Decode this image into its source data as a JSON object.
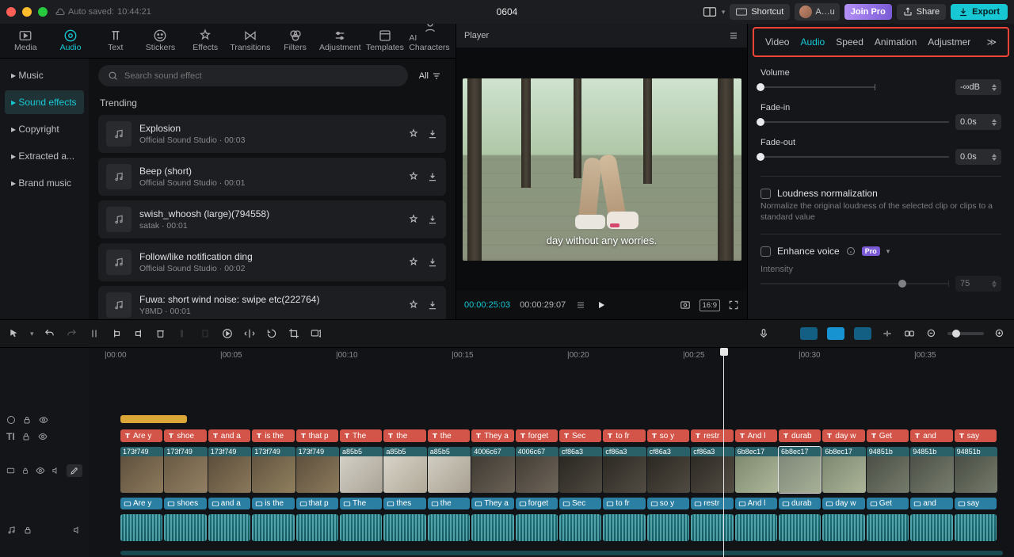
{
  "titlebar": {
    "autosave_label": "Auto saved:",
    "autosave_time": "10:44:21",
    "project_name": "0604",
    "shortcut": "Shortcut",
    "user": "A…u",
    "join_pro": "Join Pro",
    "share": "Share",
    "export": "Export"
  },
  "modules": [
    {
      "id": "media",
      "label": "Media"
    },
    {
      "id": "audio",
      "label": "Audio"
    },
    {
      "id": "text",
      "label": "Text"
    },
    {
      "id": "stickers",
      "label": "Stickers"
    },
    {
      "id": "effects",
      "label": "Effects"
    },
    {
      "id": "transitions",
      "label": "Transitions"
    },
    {
      "id": "filters",
      "label": "Filters"
    },
    {
      "id": "adjustment",
      "label": "Adjustment"
    },
    {
      "id": "templates",
      "label": "Templates"
    },
    {
      "id": "ai_characters",
      "label": "AI Characters"
    }
  ],
  "library": {
    "sidebar": [
      {
        "label": "Music"
      },
      {
        "label": "Sound effects"
      },
      {
        "label": "Copyright"
      },
      {
        "label": "Extracted a..."
      },
      {
        "label": "Brand music"
      }
    ],
    "sidebar_active": 1,
    "search_placeholder": "Search sound effect",
    "all_label": "All",
    "section_title": "Trending",
    "items": [
      {
        "title": "Explosion",
        "source": "Official Sound Studio",
        "dur": "00:03"
      },
      {
        "title": "Beep (short)",
        "source": "Official Sound Studio",
        "dur": "00:01"
      },
      {
        "title": "swish_whoosh (large)(794558)",
        "source": "satak",
        "dur": "00:01"
      },
      {
        "title": "Follow/like notification ding",
        "source": "Official Sound Studio",
        "dur": "00:02"
      },
      {
        "title": "Fuwa: short wind noise: swipe etc(222764)",
        "source": "Y8MD",
        "dur": "00:01"
      }
    ]
  },
  "player": {
    "title": "Player",
    "caption": "day without any worries.",
    "timecode_current": "00:00:25:03",
    "timecode_total": "00:00:29:07",
    "ratio": "16:9"
  },
  "inspector": {
    "tabs": [
      "Video",
      "Audio",
      "Speed",
      "Animation",
      "Adjustmer"
    ],
    "active": 1,
    "volume": {
      "label": "Volume",
      "value": "-∞dB",
      "pct": 0
    },
    "fade_in": {
      "label": "Fade-in",
      "value": "0.0s",
      "pct": 0
    },
    "fade_out": {
      "label": "Fade-out",
      "value": "0.0s",
      "pct": 0
    },
    "loudness": {
      "label": "Loudness normalization",
      "desc": "Normalize the original loudness of the selected clip or clips to a standard value"
    },
    "enhance": {
      "label": "Enhance voice",
      "badge": "Pro",
      "intensity_label": "Intensity",
      "intensity_value": "75",
      "intensity_pct": 75
    }
  },
  "ruler_marks": [
    "|00:00",
    "|00:05",
    "|00:10",
    "|00:15",
    "|00:20",
    "|00:25",
    "|00:30",
    "|00:35"
  ],
  "playhead_pct": 69.2,
  "tracks": {
    "marker_clip": {
      "left_pct": 3.4,
      "width_pct": 7.1
    },
    "text_clips": [
      "Are y",
      "shoe",
      "and a",
      "is the",
      "that p",
      "The",
      "the",
      "the",
      "They a",
      "forget",
      "Sec",
      "to fr",
      "so y",
      "restr",
      "And l",
      "durab",
      "day w",
      "Get",
      "and",
      "say"
    ],
    "video_clips": [
      {
        "w": 3,
        "n": "173f749"
      },
      {
        "w": 3,
        "n": "173f749"
      },
      {
        "w": 3,
        "n": "173f749"
      },
      {
        "w": 3,
        "n": "173f749"
      },
      {
        "w": 3,
        "n": "173f749"
      },
      {
        "w": 3,
        "n": "a85b5"
      },
      {
        "w": 3,
        "n": "a85b5"
      },
      {
        "w": 3,
        "n": "a85b5"
      },
      {
        "w": 3,
        "n": "4006c67"
      },
      {
        "w": 3,
        "n": "4006c67"
      },
      {
        "w": 3,
        "n": "cf86a3"
      },
      {
        "w": 3,
        "n": "cf86a3"
      },
      {
        "w": 3,
        "n": "cf86a3"
      },
      {
        "w": 3,
        "n": "cf86a3"
      },
      {
        "w": 3,
        "n": "6b8ec17"
      },
      {
        "w": 3,
        "n": "6b8ec17"
      },
      {
        "w": 3,
        "n": "6b8ec17"
      },
      {
        "w": 3,
        "n": "94851b"
      },
      {
        "w": 3,
        "n": "94851b"
      },
      {
        "w": 3,
        "n": "94851b"
      }
    ],
    "caption_clips": [
      "Are y",
      "shoes",
      "and a",
      "is the",
      "that p",
      "The",
      "thes",
      "the",
      "They a",
      "forget",
      "Sec",
      "to fr",
      "so y",
      "restr",
      "And l",
      "durab",
      "day w",
      "Get",
      "and",
      "say"
    ]
  }
}
